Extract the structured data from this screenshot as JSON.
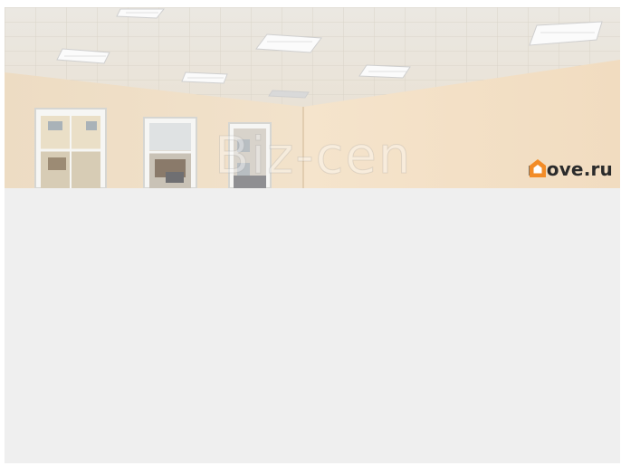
{
  "photo": {
    "watermark_text": "Biz-cen",
    "brand_name": "move.ru",
    "brand_icon": "house-icon",
    "colors": {
      "brand_orange": "#f28c28",
      "panel_background": "#efefef"
    }
  }
}
